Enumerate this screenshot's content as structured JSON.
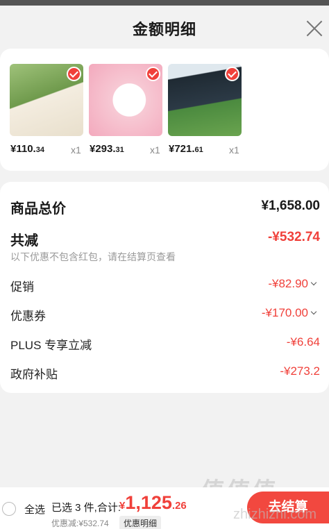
{
  "header": {
    "title": "金额明细"
  },
  "products": [
    {
      "price_int": "¥110.",
      "price_dec": "34",
      "qty": "x1",
      "colors": [
        "#6f9a4c",
        "#f4ede0"
      ]
    },
    {
      "price_int": "¥293.",
      "price_dec": "31",
      "qty": "x1",
      "colors": [
        "#f3a9bd",
        "#ffffff"
      ]
    },
    {
      "price_int": "¥721.",
      "price_dec": "61",
      "qty": "x1",
      "colors": [
        "#1f2a33",
        "#4b8a3f"
      ]
    }
  ],
  "summary": {
    "total_label": "商品总价",
    "total_value": "¥1,658.00",
    "reduction_label": "共减",
    "reduction_value": "-¥532.74",
    "note": "以下优惠不包含红包，请在结算页查看",
    "items": [
      {
        "label": "促销",
        "value": "-¥82.90",
        "expandable": true
      },
      {
        "label": "优惠券",
        "value": "-¥170.00",
        "expandable": true
      },
      {
        "label": "PLUS 专享立减",
        "value": "-¥6.64",
        "expandable": false
      },
      {
        "label": "政府补贴",
        "value": "-¥273.2",
        "expandable": false
      }
    ]
  },
  "footer": {
    "select_all": "全选",
    "selected": "已选 3 件,合计:",
    "currency": "¥",
    "total_int": "1,125",
    "total_dec": ".26",
    "discount": "优惠减:¥532.74",
    "detail_tag": "优惠明细",
    "checkout": "去结算"
  },
  "watermark": {
    "text": "值值值",
    "sub": "zhizhizhi.com"
  },
  "accent_color": "#f0403a"
}
